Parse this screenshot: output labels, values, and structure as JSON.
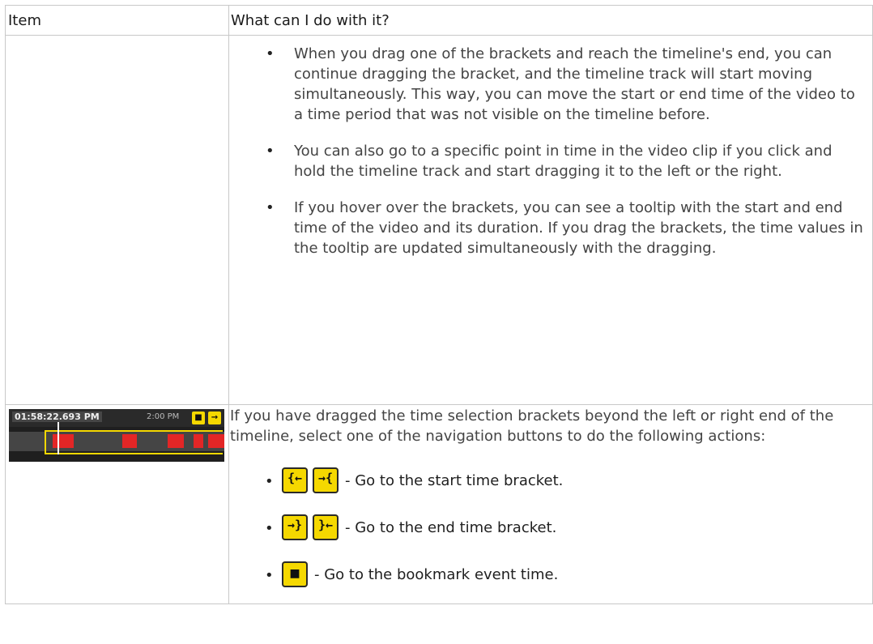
{
  "table": {
    "headers": [
      "Item",
      "What can I do with it?"
    ]
  },
  "row1": {
    "bullets": [
      "When you drag one of the brackets and reach the timeline's end, you can continue dragging the bracket, and the timeline track will start moving simultaneously. This way, you can move the start or end time of the video to a time period that was not visible on the timeline before.",
      "You can also go to a specific point in time in the video clip if you click and hold the timeline track and start dragging it to the left or the right.",
      "If you hover over the brackets, you can see a tooltip with the start and end time of the video and its duration. If you drag the brackets, the time values in the tooltip are updated simultaneously with the dragging."
    ]
  },
  "row2": {
    "timeline": {
      "time": "01:58:22.693 PM",
      "tick": "2:00 PM",
      "accent": "#f5d800",
      "segment_color": "#e32626"
    },
    "intro": "If you have dragged the time selection brackets beyond the left or right end of the timeline, select one of the navigation buttons to do the following actions:",
    "nav": [
      {
        "icons": [
          "go-to-start-icon",
          "go-to-start-alt-icon"
        ],
        "text": "- Go to the start time bracket."
      },
      {
        "icons": [
          "go-to-end-icon",
          "go-to-end-alt-icon"
        ],
        "text": "- Go to the end time bracket."
      },
      {
        "icons": [
          "bookmark-icon"
        ],
        "text": "- Go to the bookmark event time."
      }
    ]
  }
}
